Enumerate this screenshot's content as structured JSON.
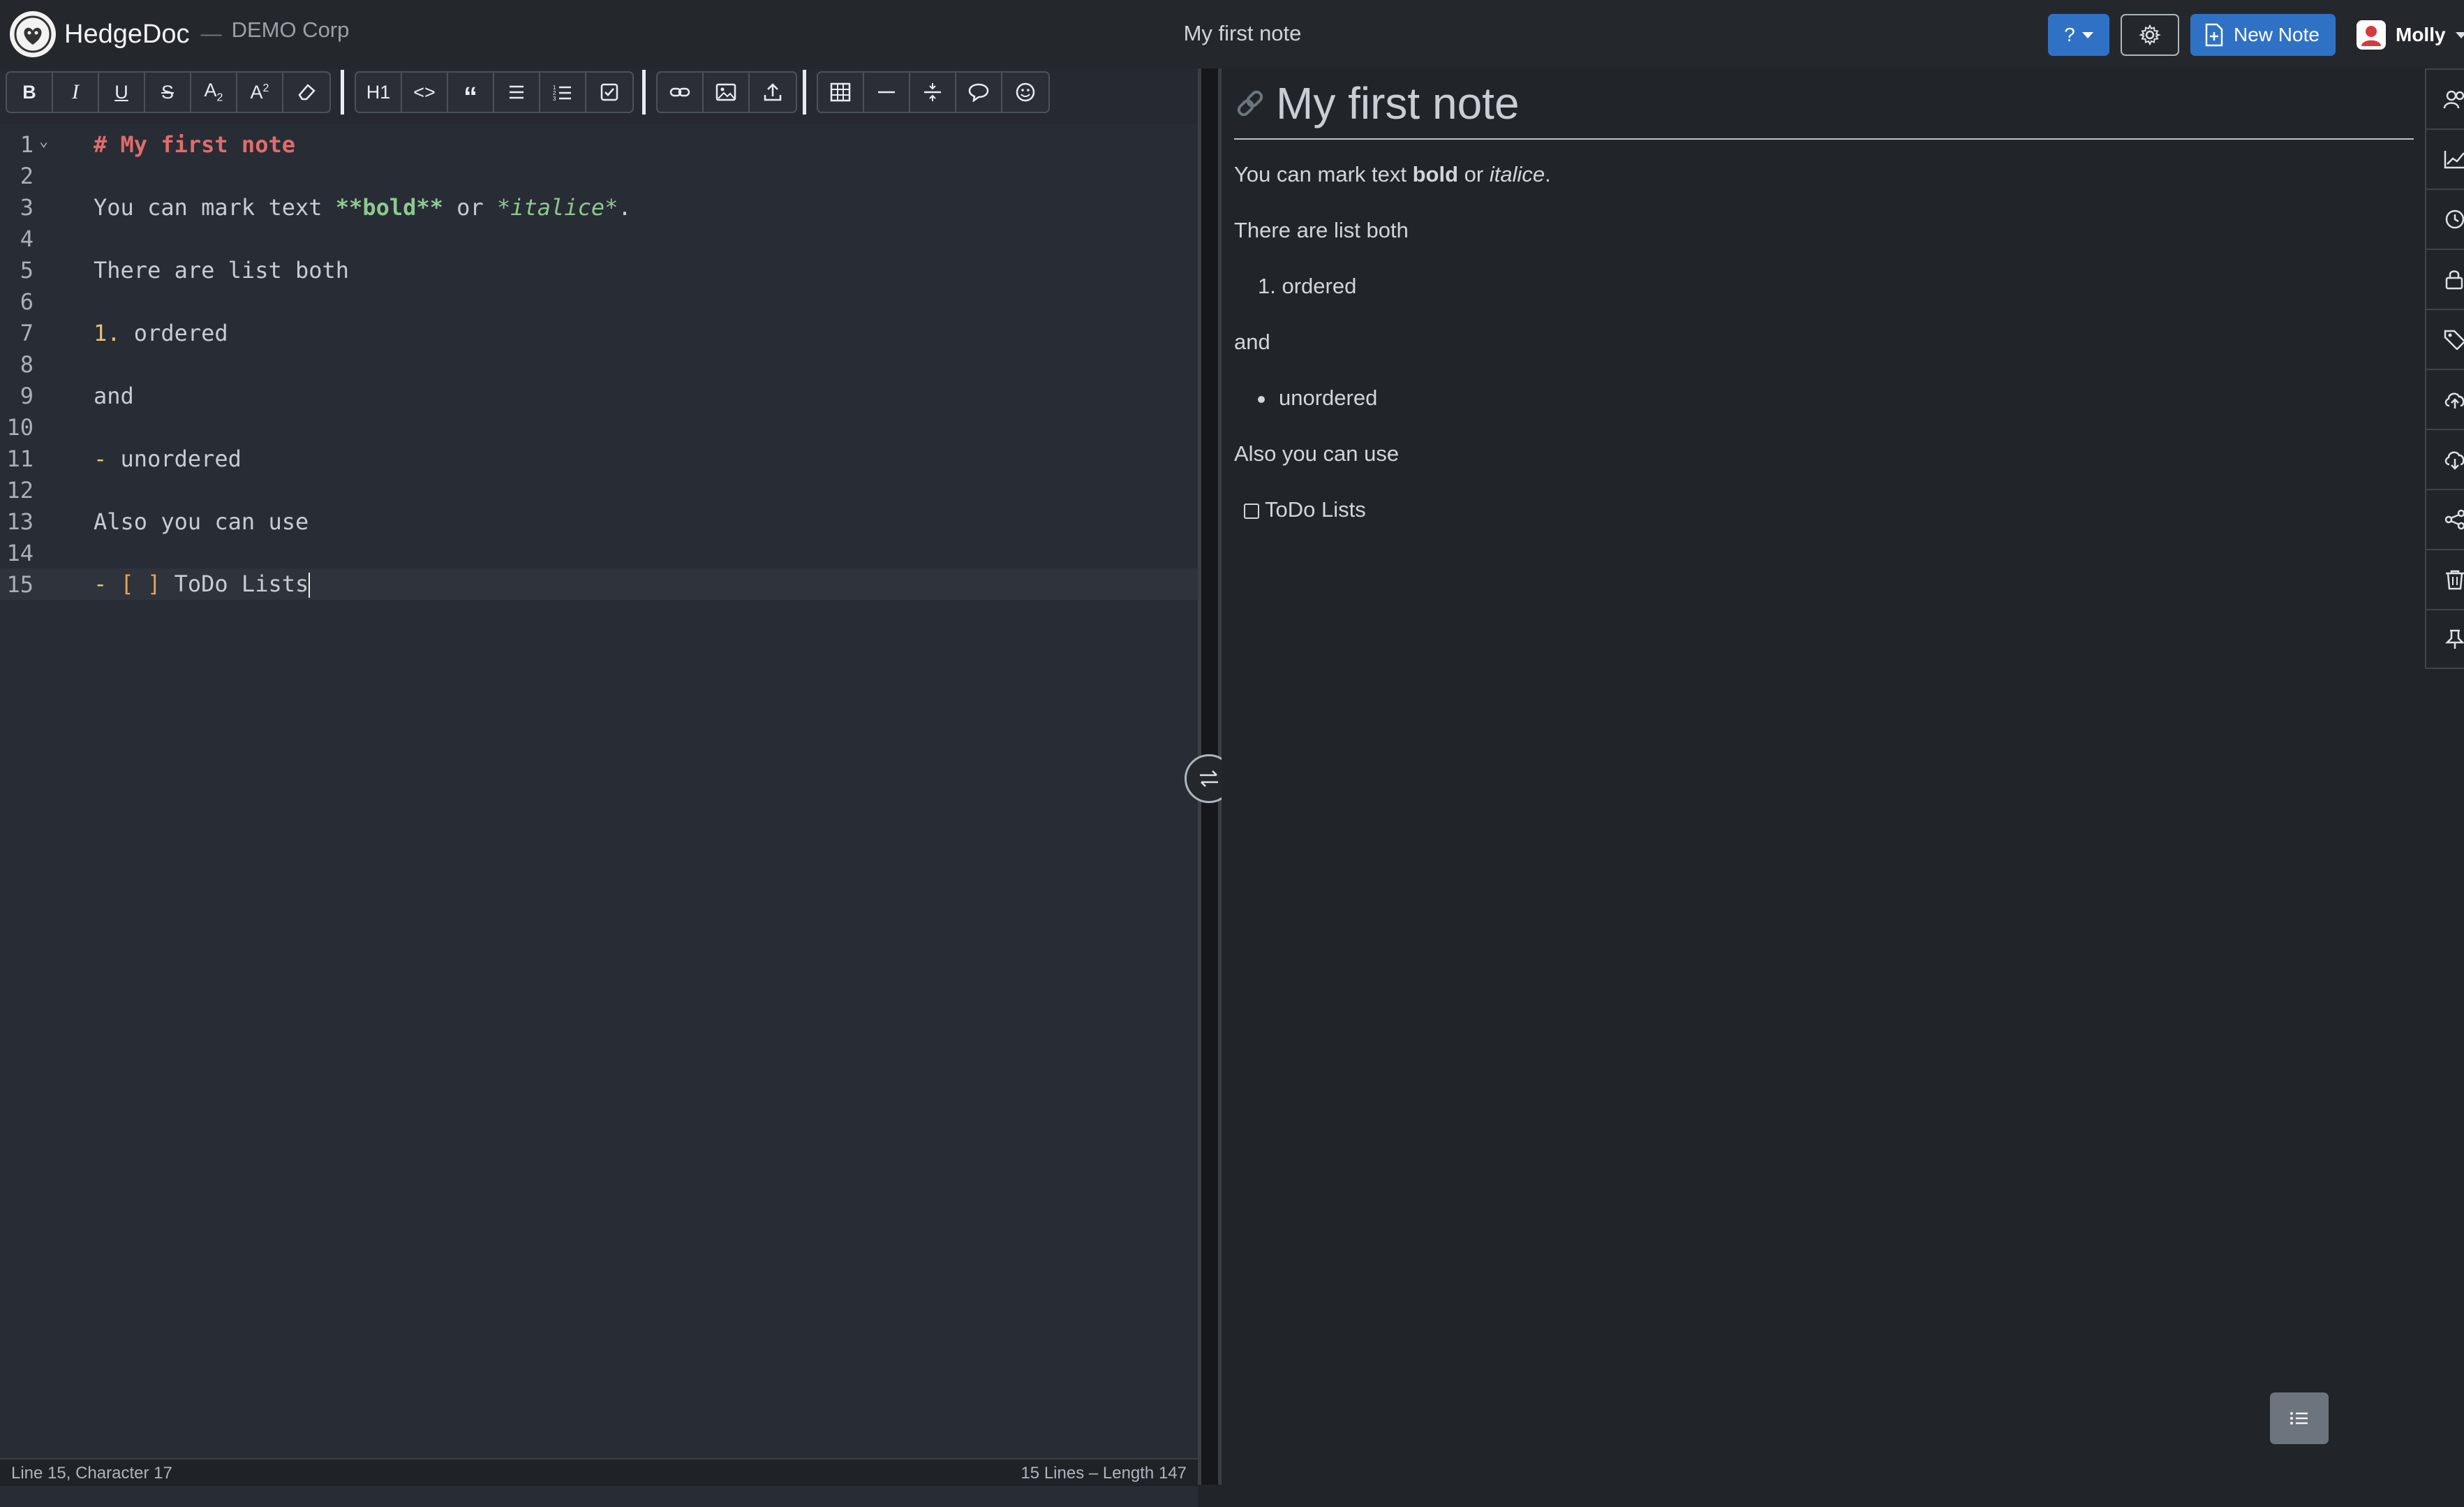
{
  "app": {
    "brand": "HedgeDoc",
    "separator": "—",
    "org": "DEMO Corp",
    "note_title": "My first note"
  },
  "header": {
    "help_label": "?",
    "new_note_label": "New Note",
    "user_name": "Molly"
  },
  "toolbar": {
    "groups": [
      [
        "bold-icon",
        "italic-icon",
        "underline-icon",
        "strikethrough-icon",
        "subscript-icon",
        "superscript-icon",
        "eraser-icon"
      ],
      [
        "heading-icon",
        "code-icon",
        "quote-icon",
        "bulleted-list-icon",
        "numbered-list-icon",
        "task-list-icon"
      ],
      [
        "link-icon",
        "image-icon",
        "upload-icon"
      ],
      [
        "table-icon",
        "horizontal-line-icon",
        "collapsible-icon",
        "comment-icon",
        "emoji-icon"
      ]
    ],
    "h1_label": "H1"
  },
  "editor": {
    "lines": [
      "# My first note",
      "",
      "You can mark text **bold** or *italice*.",
      "",
      "There are list both",
      "",
      "1. ordered",
      "",
      "and",
      "",
      "- unordered",
      "",
      "Also you can use",
      "",
      "- [ ] ToDo Lists"
    ],
    "active_line": 15
  },
  "status": {
    "position": "Line 15, Character 17",
    "summary": "15 Lines – Length 147"
  },
  "preview": {
    "title": "My first note",
    "p1_before": "You can mark text ",
    "p1_bold": "bold",
    "p1_mid": " or ",
    "p1_italic": "italice",
    "p1_end": ".",
    "p2": "There are list both",
    "ol_num": "1.",
    "ol_item": "ordered",
    "p3": "and",
    "ul_item": "unordered",
    "p4": "Also you can use",
    "task_item": "ToDo Lists"
  },
  "sidebar": {
    "items": [
      "users-icon",
      "chart-icon",
      "history-icon",
      "lock-icon",
      "tag-icon",
      "cloud-upload-icon",
      "cloud-download-icon",
      "share-icon",
      "trash-icon",
      "pin-icon"
    ]
  },
  "colors": {
    "accent": "#2f72c5",
    "heading": "#e06c6c",
    "emphasis": "#8dc891",
    "list_marker": "#e5c07b"
  }
}
